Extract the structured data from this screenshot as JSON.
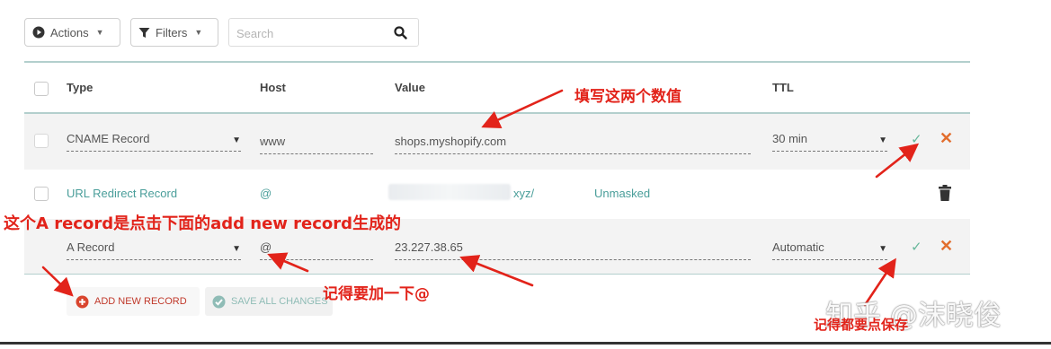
{
  "toolbar": {
    "actions_label": "Actions",
    "filters_label": "Filters",
    "search_placeholder": "Search"
  },
  "table": {
    "headers": {
      "type": "Type",
      "host": "Host",
      "value": "Value",
      "ttl": "TTL"
    },
    "rows": [
      {
        "type": "CNAME Record",
        "host": "www",
        "value": "shops.myshopify.com",
        "ttl": "30 min"
      },
      {
        "type": "URL Redirect Record",
        "host": "@",
        "value": "xyz/",
        "mode": "Unmasked"
      },
      {
        "type": "A Record",
        "host": "@",
        "value": "23.227.38.65",
        "ttl": "Automatic"
      }
    ]
  },
  "buttons": {
    "add_new_record": "ADD NEW RECORD",
    "save_all_changes": "SAVE ALL CHANGES"
  },
  "annotations": {
    "fill_values": "填写这两个数值",
    "a_record_note": "这个A record是点击下面的add new record生成的",
    "remember_at": "记得要加一下@",
    "remember_save": "记得都要点保存"
  },
  "watermark": "知乎 @沫晓俊",
  "colors": {
    "accent_teal": "#4a9e9a",
    "confirm_green": "#67b79b",
    "cancel_orange": "#e26d2d",
    "annotation_red": "#e2231a",
    "row_edit_bg": "#f3f3f3"
  }
}
